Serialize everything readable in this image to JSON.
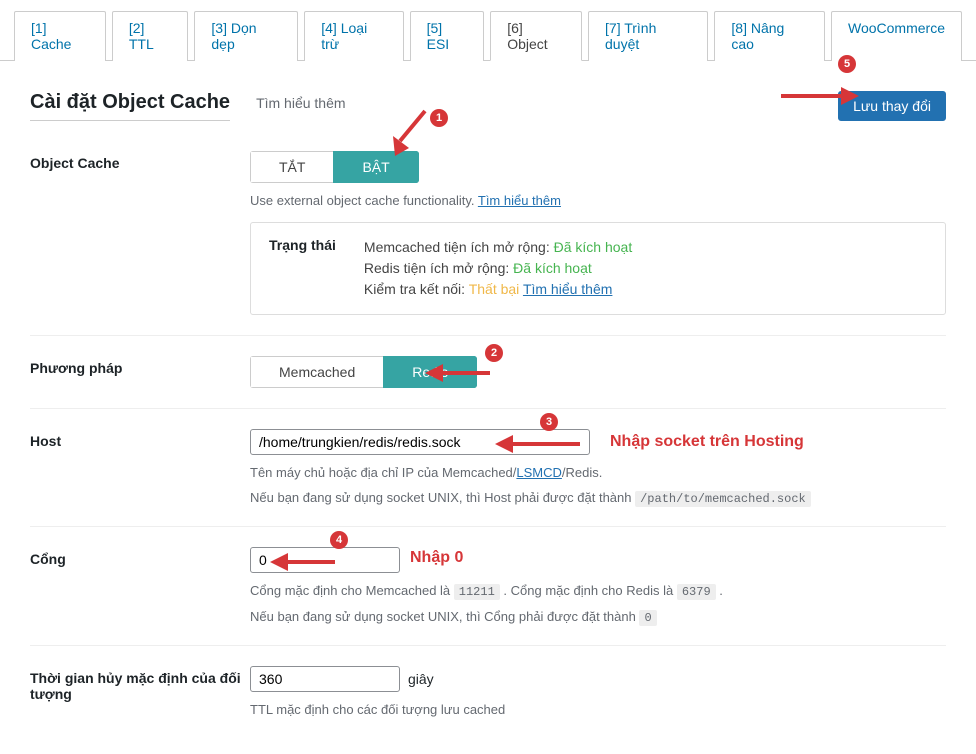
{
  "tabs": {
    "t1": "[1] Cache",
    "t2": "[2] TTL",
    "t3": "[3] Dọn dẹp",
    "t4": "[4] Loại trừ",
    "t5": "[5] ESI",
    "t6": "[6] Object",
    "t7": "[7] Trình duyệt",
    "t8": "[8] Nâng cao",
    "t9": "WooCommerce"
  },
  "header": {
    "title": "Cài đặt Object Cache",
    "learn_more": "Tìm hiểu thêm",
    "save_label": "Lưu thay đổi"
  },
  "obj_cache": {
    "label": "Object Cache",
    "off": "TẮT",
    "on": "BẬT",
    "help_a": "Use external object cache functionality. ",
    "help_link": "Tìm hiểu thêm",
    "status_label": "Trạng thái",
    "memcached_line": "Memcached tiện ích mở rộng: ",
    "redis_line": "Redis tiện ích mở rộng: ",
    "activated": "Đã kích hoạt",
    "conn_line": "Kiểm tra kết nối: ",
    "fail": "Thất bại",
    "learn_link": "Tìm hiểu thêm"
  },
  "method": {
    "label": "Phương pháp",
    "memcached": "Memcached",
    "redis": "Redis"
  },
  "host": {
    "label": "Host",
    "value": "/home/trungkien/redis/redis.sock",
    "help1a": "Tên máy chủ hoặc địa chỉ IP của Memcached/",
    "help1_link": "LSMCD",
    "help1b": "/Redis.",
    "help2a": "Nếu bạn đang sử dụng socket UNIX, thì Host phải được đặt thành ",
    "help2_code": "/path/to/memcached.sock",
    "note": "Nhập socket trên Hosting"
  },
  "port": {
    "label": "Cổng",
    "value": "0",
    "help1a": "Cổng mặc định cho Memcached là ",
    "help1_code1": "11211",
    "help1b": " . Cổng mặc định cho Redis là ",
    "help1_code2": "6379",
    "help1c": " .",
    "help2a": "Nếu bạn đang sử dụng socket UNIX, thì Cổng phải được đặt thành ",
    "help2_code": "0",
    "note": "Nhập 0"
  },
  "ttl": {
    "label": "Thời gian hủy mặc định của đối tượng",
    "value": "360",
    "unit": "giây",
    "help": "TTL mặc định cho các đối tượng lưu cached"
  },
  "badges": {
    "n1": "1",
    "n2": "2",
    "n3": "3",
    "n4": "4",
    "n5": "5"
  }
}
